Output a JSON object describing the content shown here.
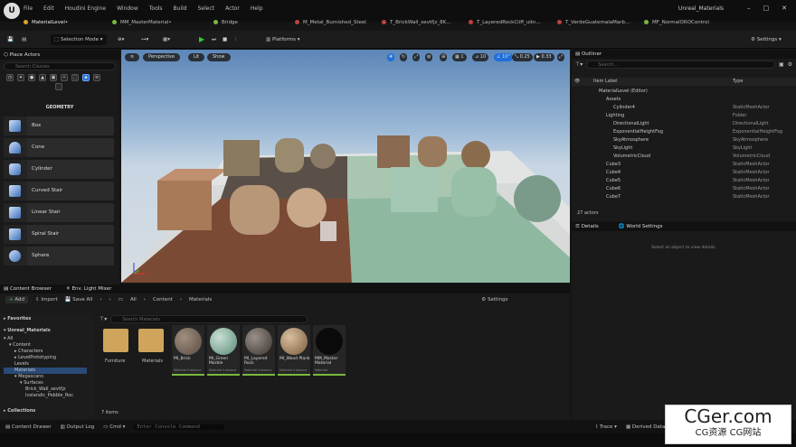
{
  "title": {
    "app": "Unreal_Materials",
    "menu": [
      "File",
      "Edit",
      "Houdini Engine",
      "Window",
      "Tools",
      "Build",
      "Select",
      "Actor",
      "Help"
    ]
  },
  "tabs": [
    "MaterialLevel•",
    "MM_MasterMaterial•",
    "Bridge",
    "M_Metal_Burnished_Steel",
    "T_BrickWall_xevtfjz_8K...",
    "T_LayeredRockCliff_uitn...",
    "T_VerdeGuatemalaMarb...",
    "MF_NormalOROControl"
  ],
  "tab_colors": [
    "#e0a030",
    "#7ab83f",
    "#7ab83f",
    "#c04040",
    "#c04040",
    "#c04040",
    "#c04040",
    "#7ab83f"
  ],
  "toolbar": {
    "mode": "Selection Mode",
    "platforms": "Platforms",
    "settings": "Settings"
  },
  "place_actors": {
    "title": "Place Actors",
    "search": "Search Classes",
    "category": "GEOMETRY",
    "items": [
      "Box",
      "Cone",
      "Cylinder",
      "Curved Stair",
      "Linear Stair",
      "Spiral Stair",
      "Sphere"
    ]
  },
  "viewport": {
    "perspective": "Perspective",
    "lit": "Lit",
    "show": "Show",
    "grid": "10",
    "angle": "10°",
    "scale": "0.25",
    "camera": "0.33",
    "speed": "1"
  },
  "outliner": {
    "title": "Outliner",
    "search": "Search...",
    "col_label": "Item Label",
    "col_type": "Type",
    "count": "27 actors",
    "rows": [
      {
        "name": "MaterialLevel (Editor)",
        "type": "",
        "indent": 0
      },
      {
        "name": "Assets",
        "type": "",
        "indent": 1
      },
      {
        "name": "Cylinder4",
        "type": "StaticMeshActor",
        "indent": 2
      },
      {
        "name": "Lighting",
        "type": "Folder",
        "indent": 1
      },
      {
        "name": "DirectionalLight",
        "type": "DirectionalLight",
        "indent": 2
      },
      {
        "name": "ExponentialHeightFog",
        "type": "ExponentialHeightFog",
        "indent": 2
      },
      {
        "name": "SkyAtmosphere",
        "type": "SkyAtmosphere",
        "indent": 2
      },
      {
        "name": "SkyLight",
        "type": "SkyLight",
        "indent": 2
      },
      {
        "name": "VolumetricCloud",
        "type": "VolumetricCloud",
        "indent": 2
      },
      {
        "name": "Cube3",
        "type": "StaticMeshActor",
        "indent": 1
      },
      {
        "name": "Cube4",
        "type": "StaticMeshActor",
        "indent": 1
      },
      {
        "name": "Cube5",
        "type": "StaticMeshActor",
        "indent": 1
      },
      {
        "name": "Cube6",
        "type": "StaticMeshActor",
        "indent": 1
      },
      {
        "name": "Cube7",
        "type": "StaticMeshActor",
        "indent": 1
      }
    ]
  },
  "details": {
    "title": "Details",
    "world": "World Settings",
    "empty": "Select an object to view details."
  },
  "content_browser": {
    "tab": "Content Browser",
    "tab2": "Env. Light Mixer",
    "add": "Add",
    "import": "Import",
    "save_all": "Save All",
    "path": [
      "All",
      "Content",
      "Materials"
    ],
    "settings": "Settings",
    "search": "Search Materials",
    "items_count": "7 items",
    "favorites": "Favorites",
    "project": "Unreal_Materials",
    "collections": "Collections",
    "tree": [
      "All",
      "Content",
      "Characters",
      "LevelPrototyping",
      "Levels",
      "Materials",
      "Megascans",
      "Surfaces",
      "Brick_Wall_xevtfjz",
      "Icelandic_Pebble_Roc"
    ],
    "folders": [
      "Furniture",
      "Materials"
    ],
    "materials": [
      {
        "name": "MI_Brick",
        "sub": "Material Instance"
      },
      {
        "name": "MI_Green Marble",
        "sub": "Material Instance"
      },
      {
        "name": "MI_Layered Rock",
        "sub": "Material Instance"
      },
      {
        "name": "MI_Wood Plank",
        "sub": "Material Instance"
      },
      {
        "name": "MM_Master Material",
        "sub": "Material"
      }
    ]
  },
  "status": {
    "drawer": "Content Drawer",
    "log": "Output Log",
    "cmd": "Cmd",
    "console": "Enter Console Command",
    "trace": "Trace",
    "derived": "Derived Data"
  },
  "watermark": {
    "brand": "CGer.com",
    "sub": "CG资源 CG网站"
  }
}
